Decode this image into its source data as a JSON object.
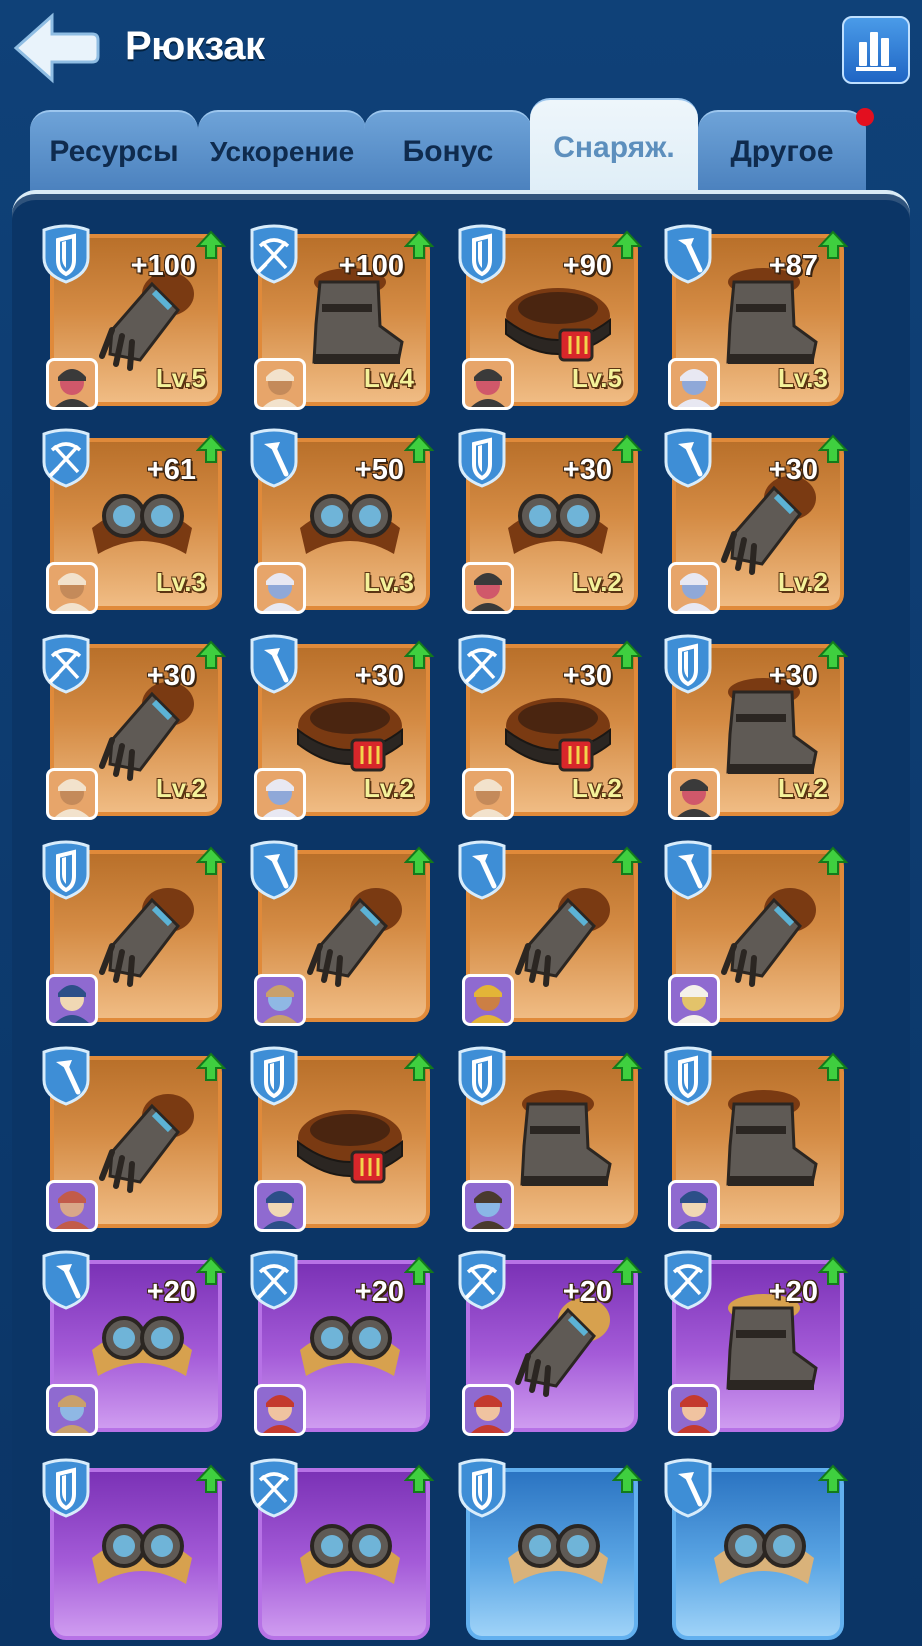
{
  "header": {
    "title": "Рюкзак",
    "back_icon": "back-arrow-icon",
    "stats_icon": "bar-chart-icon"
  },
  "tabs": [
    {
      "label": "Ресурсы",
      "active": false,
      "notification": false
    },
    {
      "label": "Ускорение",
      "active": false,
      "notification": false
    },
    {
      "label": "Бонус",
      "active": false,
      "notification": false
    },
    {
      "label": "Снаряж.",
      "active": true,
      "notification": false
    },
    {
      "label": "Другое",
      "active": false,
      "notification": true
    }
  ],
  "colors": {
    "background": "#0b3566",
    "rarity_orange": "#e08a3a",
    "rarity_purple": "#b772e6",
    "rarity_blue": "#62b0ef",
    "upgrade_arrow": "#35c23b",
    "notification": "#e30f1f"
  },
  "items": [
    {
      "row": 0,
      "col": 0,
      "rarity": "orange",
      "type": "shield",
      "item": "gauntlet",
      "bonus": "+100",
      "level": "Lv.5",
      "hero": "knight"
    },
    {
      "row": 0,
      "col": 1,
      "rarity": "orange",
      "type": "crossbow",
      "item": "boot",
      "bonus": "+100",
      "level": "Lv.4",
      "hero": "old-man"
    },
    {
      "row": 0,
      "col": 2,
      "rarity": "orange",
      "type": "shield",
      "item": "belt",
      "bonus": "+90",
      "level": "Lv.5",
      "hero": "knight"
    },
    {
      "row": 0,
      "col": 3,
      "rarity": "orange",
      "type": "hammer",
      "item": "boot",
      "bonus": "+87",
      "level": "Lv.3",
      "hero": "girl"
    },
    {
      "row": 1,
      "col": 0,
      "rarity": "orange",
      "type": "crossbow",
      "item": "goggles",
      "bonus": "+61",
      "level": "Lv.3",
      "hero": "old-man"
    },
    {
      "row": 1,
      "col": 1,
      "rarity": "orange",
      "type": "hammer",
      "item": "goggles",
      "bonus": "+50",
      "level": "Lv.3",
      "hero": "girl"
    },
    {
      "row": 1,
      "col": 2,
      "rarity": "orange",
      "type": "shield",
      "item": "goggles",
      "bonus": "+30",
      "level": "Lv.2",
      "hero": "knight"
    },
    {
      "row": 1,
      "col": 3,
      "rarity": "orange",
      "type": "hammer",
      "item": "gauntlet",
      "bonus": "+30",
      "level": "Lv.2",
      "hero": "girl"
    },
    {
      "row": 2,
      "col": 0,
      "rarity": "orange",
      "type": "crossbow",
      "item": "gauntlet",
      "bonus": "+30",
      "level": "Lv.2",
      "hero": "old-man"
    },
    {
      "row": 2,
      "col": 1,
      "rarity": "orange",
      "type": "hammer",
      "item": "belt",
      "bonus": "+30",
      "level": "Lv.2",
      "hero": "girl"
    },
    {
      "row": 2,
      "col": 2,
      "rarity": "orange",
      "type": "crossbow",
      "item": "belt",
      "bonus": "+30",
      "level": "Lv.2",
      "hero": "old-man"
    },
    {
      "row": 2,
      "col": 3,
      "rarity": "orange",
      "type": "shield",
      "item": "boot",
      "bonus": "+30",
      "level": "Lv.2",
      "hero": "knight"
    },
    {
      "row": 3,
      "col": 0,
      "rarity": "orange",
      "type": "shield",
      "item": "gauntlet",
      "bonus": "",
      "level": "",
      "hero": "viking"
    },
    {
      "row": 3,
      "col": 1,
      "rarity": "orange",
      "type": "hammer",
      "item": "gauntlet",
      "bonus": "",
      "level": "",
      "hero": "dwarf"
    },
    {
      "row": 3,
      "col": 2,
      "rarity": "orange",
      "type": "hammer",
      "item": "gauntlet",
      "bonus": "",
      "level": "",
      "hero": "miner"
    },
    {
      "row": 3,
      "col": 3,
      "rarity": "orange",
      "type": "hammer",
      "item": "gauntlet",
      "bonus": "",
      "level": "",
      "hero": "chef"
    },
    {
      "row": 4,
      "col": 0,
      "rarity": "orange",
      "type": "hammer",
      "item": "gauntlet",
      "bonus": "",
      "level": "",
      "hero": "adventurer"
    },
    {
      "row": 4,
      "col": 1,
      "rarity": "orange",
      "type": "shield",
      "item": "belt",
      "bonus": "",
      "level": "",
      "hero": "viking"
    },
    {
      "row": 4,
      "col": 2,
      "rarity": "orange",
      "type": "shield",
      "item": "boot",
      "bonus": "",
      "level": "",
      "hero": "pilot"
    },
    {
      "row": 4,
      "col": 3,
      "rarity": "orange",
      "type": "shield",
      "item": "boot",
      "bonus": "",
      "level": "",
      "hero": "viking"
    },
    {
      "row": 5,
      "col": 0,
      "rarity": "purple",
      "type": "hammer",
      "item": "goggles",
      "bonus": "+20",
      "level": "",
      "hero": "dwarf"
    },
    {
      "row": 5,
      "col": 1,
      "rarity": "purple",
      "type": "crossbow",
      "item": "goggles",
      "bonus": "+20",
      "level": "",
      "hero": "redhead"
    },
    {
      "row": 5,
      "col": 2,
      "rarity": "purple",
      "type": "crossbow",
      "item": "gauntlet",
      "bonus": "+20",
      "level": "",
      "hero": "redhead"
    },
    {
      "row": 5,
      "col": 3,
      "rarity": "purple",
      "type": "crossbow",
      "item": "boot",
      "bonus": "+20",
      "level": "",
      "hero": "redhead"
    },
    {
      "row": 6,
      "col": 0,
      "rarity": "purple",
      "type": "shield",
      "item": "goggles",
      "bonus": "",
      "level": "",
      "hero": ""
    },
    {
      "row": 6,
      "col": 1,
      "rarity": "purple",
      "type": "crossbow",
      "item": "goggles",
      "bonus": "",
      "level": "",
      "hero": ""
    },
    {
      "row": 6,
      "col": 2,
      "rarity": "blue",
      "type": "shield",
      "item": "goggles",
      "bonus": "",
      "level": "",
      "hero": ""
    },
    {
      "row": 6,
      "col": 3,
      "rarity": "blue",
      "type": "hammer",
      "item": "goggles",
      "bonus": "",
      "level": "",
      "hero": ""
    }
  ]
}
